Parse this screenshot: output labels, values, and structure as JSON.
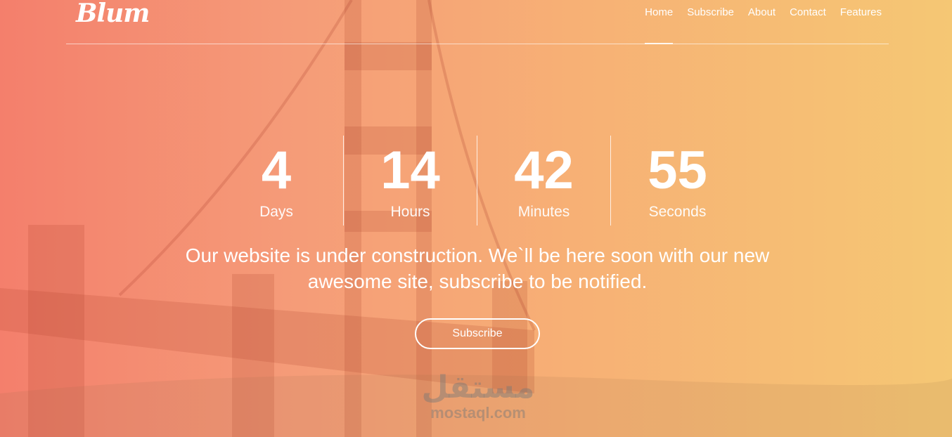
{
  "brand": {
    "logo_text": "Blum"
  },
  "nav": {
    "items": [
      {
        "label": "Home",
        "active": true
      },
      {
        "label": "Subscribe",
        "active": false
      },
      {
        "label": "About",
        "active": false
      },
      {
        "label": "Contact",
        "active": false
      },
      {
        "label": "Features",
        "active": false
      }
    ]
  },
  "countdown": [
    {
      "value": "4",
      "label": "Days"
    },
    {
      "value": "14",
      "label": "Hours"
    },
    {
      "value": "42",
      "label": "Minutes"
    },
    {
      "value": "55",
      "label": "Seconds"
    }
  ],
  "hero": {
    "message": "Our website is under construction. We`ll be here soon with our new awesome site, subscribe to be notified.",
    "button_label": "Subscribe"
  },
  "watermark": {
    "arabic": "مستقل",
    "latin": "mostaql.com"
  },
  "colors": {
    "gradient_start": "#f47f6c",
    "gradient_end": "#f5c774",
    "text": "#ffffff"
  }
}
